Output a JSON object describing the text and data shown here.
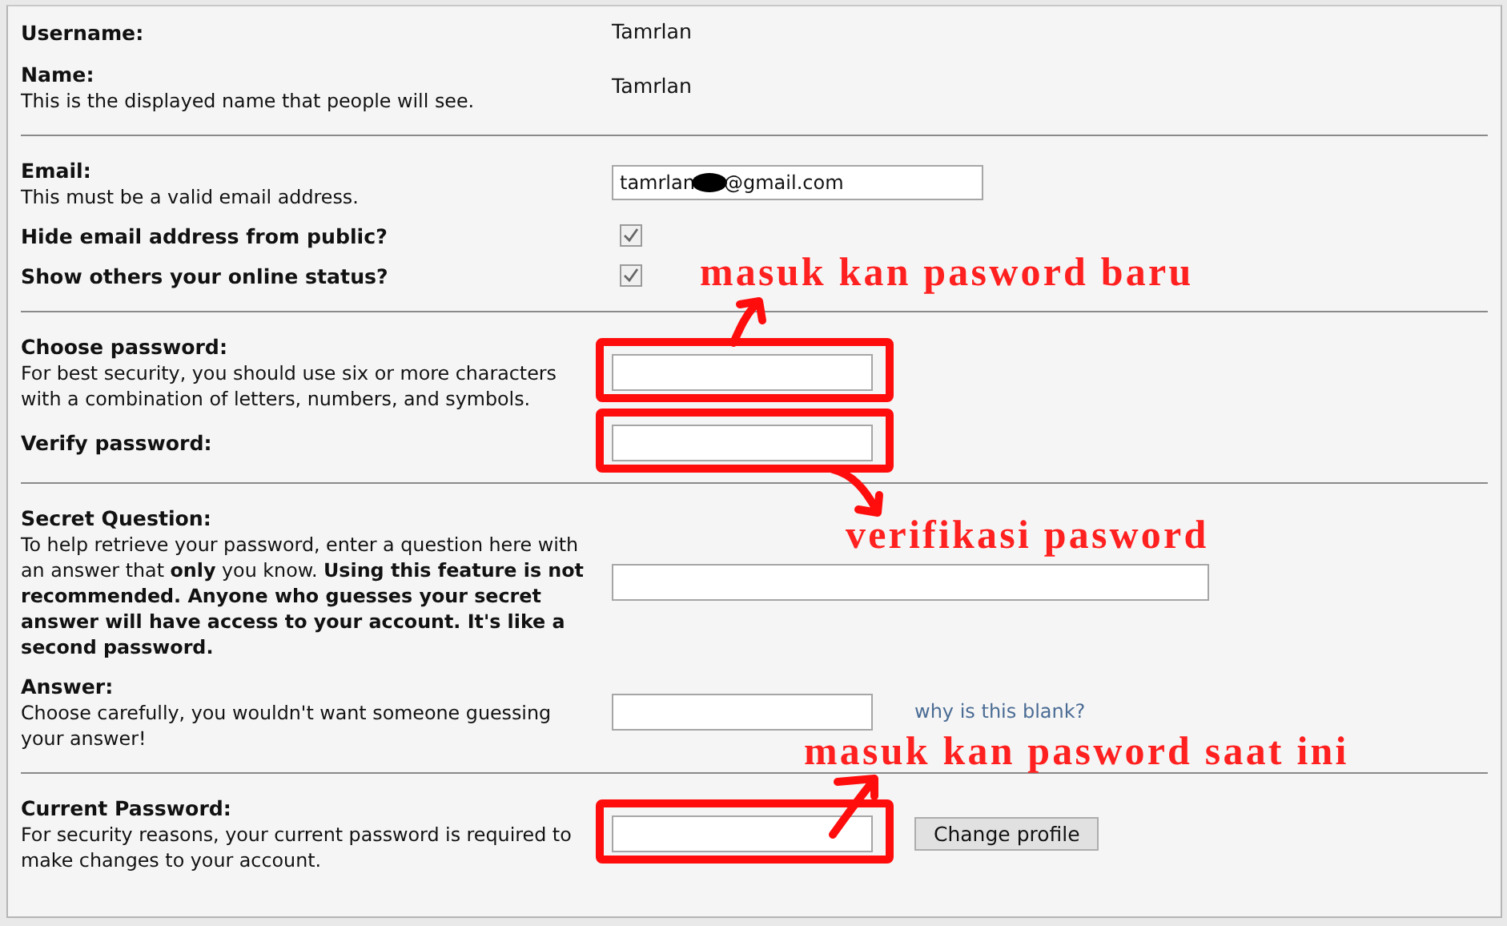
{
  "sections": [
    {
      "rows": [
        {
          "kind": "text",
          "label": "Username:",
          "value": "Tamrlan"
        },
        {
          "kind": "text",
          "label": "Name:",
          "description": "This is the displayed name that people will see.",
          "value": "Tamrlan"
        }
      ]
    },
    {
      "rows": [
        {
          "kind": "email",
          "label": "Email:",
          "description": "This must be a valid email address.",
          "value_before": "tamrlan",
          "value_after": "@gmail.com",
          "redacted": true
        },
        {
          "kind": "checkbox",
          "label": "Hide email address from public?",
          "checked": true
        },
        {
          "kind": "checkbox",
          "label": "Show others your online status?",
          "checked": true
        }
      ]
    },
    {
      "rows": [
        {
          "kind": "password",
          "label": "Choose password:",
          "description": "For best security, you should use six or more characters with a combination of letters, numbers, and symbols.",
          "circled": true
        },
        {
          "kind": "password",
          "label": "Verify password:",
          "circled": true
        }
      ]
    },
    {
      "rows": [
        {
          "kind": "wide_input",
          "label": "Secret Question:",
          "description": "To help retrieve your password, enter a question here with an answer that **only** you know. **Using this feature is not recommended. Anyone who guesses your secret answer will have access to your account. It's like a second password.**"
        },
        {
          "kind": "input",
          "label": "Answer:",
          "description": "Choose carefully, you wouldn't want someone guessing your answer!",
          "link": "why is this blank?"
        }
      ]
    },
    {
      "rows": [
        {
          "kind": "password",
          "label": "Current Password:",
          "description": "For security reasons, your current password is required to make changes to your account.",
          "circled": true,
          "button": "Change profile"
        }
      ]
    }
  ],
  "annotations": [
    {
      "text": "masuk kan pasword baru"
    },
    {
      "text": "verifikasi pasword"
    },
    {
      "text": "masuk kan pasword saat ini"
    }
  ]
}
